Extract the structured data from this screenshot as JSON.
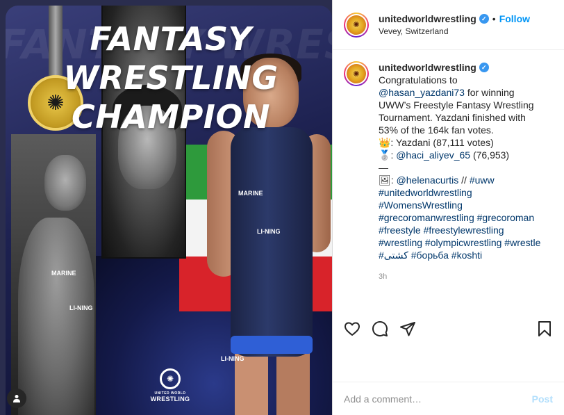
{
  "post_image": {
    "headline_line1": "FANTASY WRESTLING",
    "headline_line2": "CHAMPION",
    "ghost_text": "FANTASY WRESTLING G",
    "suit_brand": "LI-NING",
    "suit_sponsor": "MARINE",
    "uww_logo_line1": "UNITED WORLD",
    "uww_logo_line2": "WRESTLING",
    "icons": [
      "uww-medal-logo",
      "user-tag-icon"
    ],
    "colors": {
      "flag_green": "#2e9a3c",
      "flag_white": "#f3f3f3",
      "flag_red": "#d8232a",
      "medal_gold": "#e8c74a"
    }
  },
  "header": {
    "username": "unitedworldwrestling",
    "separator": "•",
    "follow_label": "Follow",
    "location": "Vevey, Switzerland"
  },
  "caption": {
    "username": "unitedworldwrestling",
    "text_1": "Congratulations to ",
    "mention_1": "@hasan_yazdani73",
    "text_2": " for winning UWW’s Freestyle Fantasy Wrestling Tournament. Yazdani finished with 53% of the 164k fan votes.",
    "line_crown": "👑: Yazdani (87,111 votes)",
    "line_silver_icon": "🥈",
    "line_silver_prefix": ": ",
    "mention_2": "@haci_aliyev_65",
    "line_silver_suffix": " (76,953)",
    "divider": "—",
    "photo_icon": "🖼",
    "photo_prefix": ": ",
    "mention_3": "@helenacurtis",
    "photo_sep": " // ",
    "hashtags": [
      "#uww",
      "#unitedworldwrestling",
      "#WomensWrestling",
      "#grecoromanwrestling",
      "#grecoroman",
      "#freestyle",
      "#freestylewrestling",
      "#wrestling",
      "#olympicwrestling",
      "#wrestle",
      "#کشتی",
      "#борьба",
      "#koshti"
    ],
    "time": "3h"
  },
  "actions": {
    "icons": [
      "heart-icon",
      "comment-icon",
      "share-icon",
      "bookmark-icon"
    ]
  },
  "comment": {
    "placeholder": "Add a comment…",
    "post_label": "Post"
  },
  "colors": {
    "link": "#00376b",
    "follow": "#0095f6",
    "post_disabled": "#b2dffc",
    "verified": "#3897f0"
  }
}
